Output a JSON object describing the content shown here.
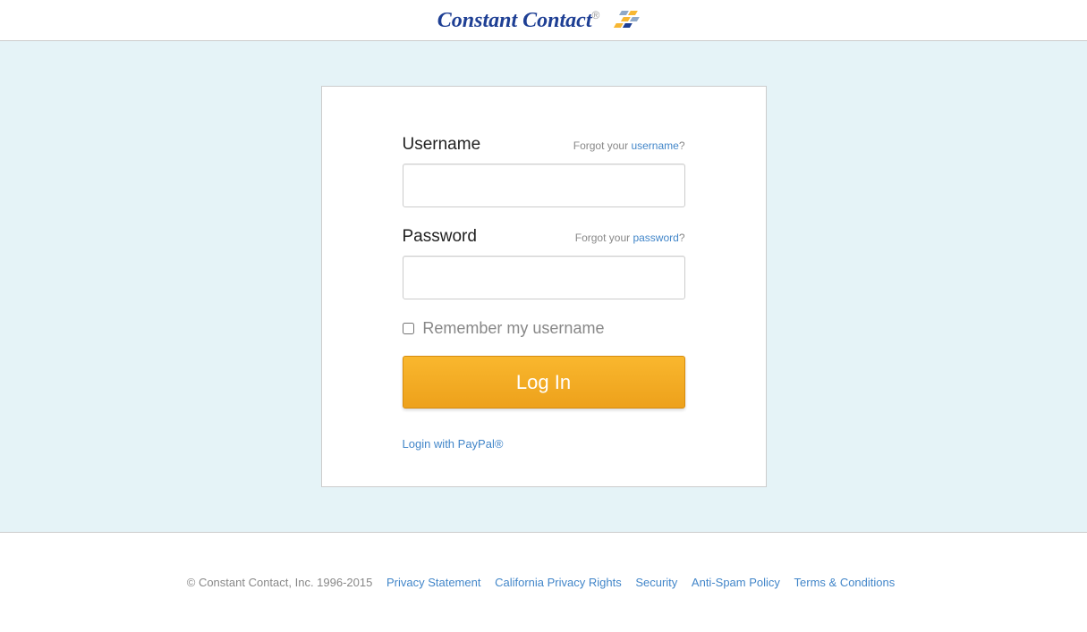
{
  "header": {
    "brand": "Constant Contact"
  },
  "login": {
    "username_label": "Username",
    "username_forgot_prefix": "Forgot your ",
    "username_forgot_link": "username",
    "username_forgot_suffix": "?",
    "password_label": "Password",
    "password_forgot_prefix": "Forgot your ",
    "password_forgot_link": "password",
    "password_forgot_suffix": "?",
    "remember_label": "Remember my username",
    "submit_label": "Log In",
    "paypal_label": "Login with PayPal®"
  },
  "footer": {
    "copyright": "© Constant Contact, Inc. 1996-2015",
    "links": {
      "privacy": "Privacy Statement",
      "california": "California Privacy Rights",
      "security": "Security",
      "antispam": "Anti-Spam Policy",
      "terms": "Terms & Conditions"
    }
  }
}
